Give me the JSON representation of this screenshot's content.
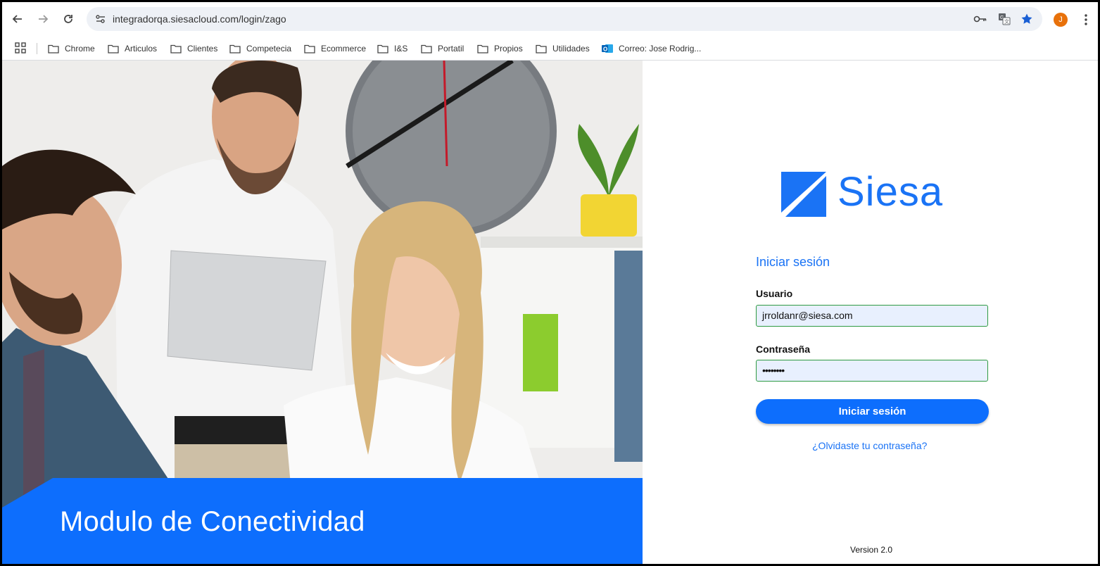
{
  "browser": {
    "url": "integradorqa.siesacloud.com/login/zago",
    "profile_initial": "J",
    "bookmarks": [
      {
        "label": "Chrome"
      },
      {
        "label": "Articulos"
      },
      {
        "label": "Clientes"
      },
      {
        "label": "Competecia"
      },
      {
        "label": "Ecommerce"
      },
      {
        "label": "I&S"
      },
      {
        "label": "Portatil"
      },
      {
        "label": "Propios"
      },
      {
        "label": "Utilidades"
      },
      {
        "label": "Correo: Jose Rodrig..."
      }
    ]
  },
  "hero": {
    "banner_text": "Modulo de Conectividad",
    "banner_color": "#0d6efd"
  },
  "login": {
    "brand": "Siesa",
    "title": "Iniciar sesión",
    "username_label": "Usuario",
    "username_value": "jrroldanr@siesa.com",
    "password_label": "Contraseña",
    "password_value": "••••••••",
    "submit_label": "Iniciar sesión",
    "forgot_link": "¿Olvidaste tu contraseña?",
    "version": "Version 2.0",
    "accent_color": "#1a73f5"
  }
}
